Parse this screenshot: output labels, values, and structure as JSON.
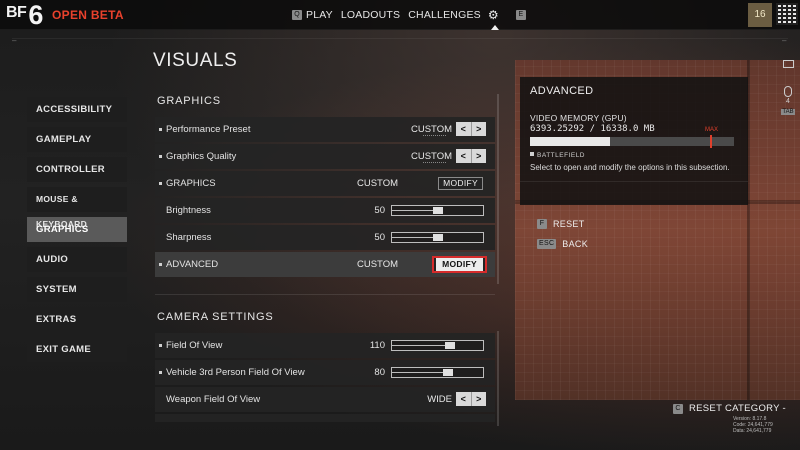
{
  "header": {
    "logo_bf": "BF",
    "logo_num": "6",
    "beta_label": "OPEN BETA",
    "key_left": "Q",
    "key_right": "E",
    "nav": [
      "PLAY",
      "LOADOUTS",
      "CHALLENGES"
    ],
    "active_icon": "gear-icon",
    "level": "16"
  },
  "page": {
    "title": "VISUALS"
  },
  "sidebar": {
    "items": [
      {
        "label": "ACCESSIBILITY"
      },
      {
        "label": "GAMEPLAY"
      },
      {
        "label": "CONTROLLER"
      },
      {
        "label": "MOUSE & KEYBOARD"
      },
      {
        "label": "GRAPHICS",
        "active": true
      },
      {
        "label": "AUDIO"
      },
      {
        "label": "SYSTEM"
      },
      {
        "label": "EXTRAS"
      },
      {
        "label": "EXIT GAME"
      }
    ]
  },
  "graphics": {
    "title": "GRAPHICS",
    "performance_preset": {
      "label": "Performance Preset",
      "value": "CUSTOM"
    },
    "graphics_quality": {
      "label": "Graphics Quality",
      "value": "CUSTOM"
    },
    "graphics_row": {
      "label": "GRAPHICS",
      "value": "CUSTOM",
      "button": "MODIFY"
    },
    "brightness": {
      "label": "Brightness",
      "value": "50",
      "fraction": 0.5
    },
    "sharpness": {
      "label": "Sharpness",
      "value": "50",
      "fraction": 0.5
    },
    "advanced": {
      "label": "ADVANCED",
      "value": "CUSTOM",
      "button": "MODIFY"
    }
  },
  "camera": {
    "title": "CAMERA SETTINGS",
    "fov": {
      "label": "Field Of View",
      "value": "110",
      "fraction": 0.64
    },
    "vehicle_fov": {
      "label": "Vehicle 3rd Person Field Of View",
      "value": "80",
      "fraction": 0.62
    },
    "weapon_fov": {
      "label": "Weapon Field Of View",
      "value": "WIDE"
    }
  },
  "advanced_panel": {
    "title": "ADVANCED",
    "vram_label": "VIDEO MEMORY (GPU)",
    "vram_value": "6393.25292 / 16338.0 MB",
    "vram_used_fraction": 0.391,
    "vram_max_fraction": 0.88,
    "max_label": "MAX",
    "tag": "BATTLEFIELD",
    "description": "Select to open and modify the options in this subsection."
  },
  "actions": {
    "reset_key": "F",
    "reset_label": "RESET",
    "back_key": "ESC",
    "back_label": "BACK",
    "reset_category_key": "C",
    "reset_category_label": "RESET CATEGORY -"
  },
  "side_icons": {
    "mouse_count": "4",
    "tab_label": "TAB"
  },
  "version_info": {
    "line1": "Version: 8.17.8",
    "line2": "Code: 24,641,779",
    "line3": "Data: 24,641,779"
  }
}
